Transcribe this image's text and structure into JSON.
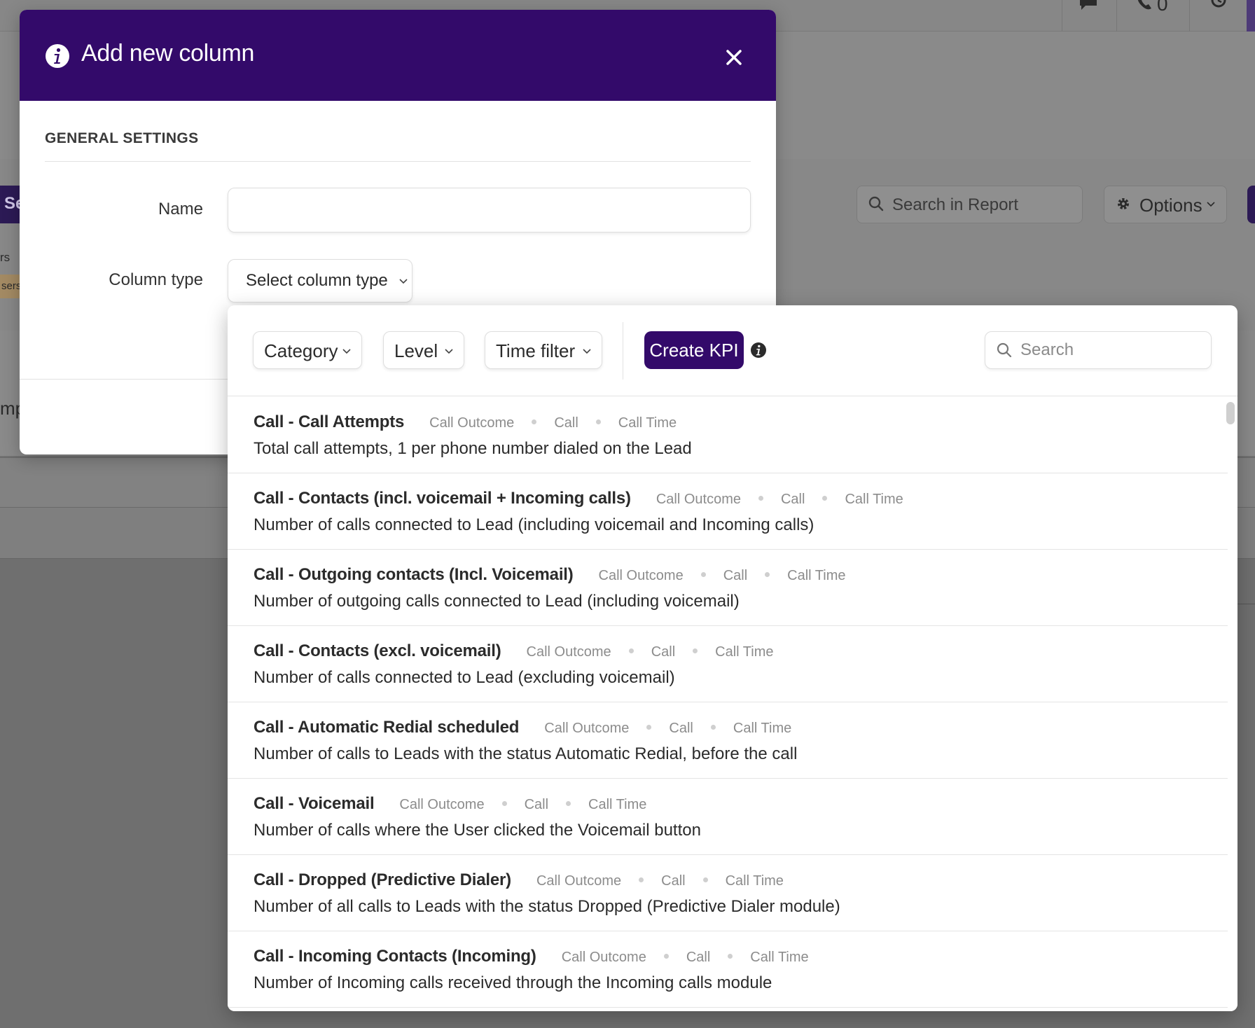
{
  "background": {
    "left_button_fragment": "Se",
    "left_text_fragment_1": "rs",
    "left_badge_fragment": "sers",
    "left_text_fragment_2": "mp",
    "topbar_count": "0",
    "search_label": "Search in Report",
    "options_label": "Options"
  },
  "modal": {
    "title": "Add new column",
    "section_title": "GENERAL SETTINGS",
    "name_label": "Name",
    "name_value": "",
    "column_type_label": "Column type",
    "column_type_value": "Select column type"
  },
  "panel": {
    "filters": {
      "category": "Category",
      "level": "Level",
      "time_filter": "Time filter"
    },
    "create_kpi_label": "Create KPI",
    "search_placeholder": "Search",
    "items": [
      {
        "title": "Call - Call Attempts",
        "tags": [
          "Call Outcome",
          "Call",
          "Call Time"
        ],
        "description": "Total call attempts, 1 per phone number dialed on the Lead"
      },
      {
        "title": "Call - Contacts (incl. voicemail + Incoming calls)",
        "tags": [
          "Call Outcome",
          "Call",
          "Call Time"
        ],
        "description": "Number of calls connected to Lead (including voicemail and Incoming calls)"
      },
      {
        "title": "Call - Outgoing contacts (Incl. Voicemail)",
        "tags": [
          "Call Outcome",
          "Call",
          "Call Time"
        ],
        "description": "Number of outgoing calls connected to Lead (including voicemail)"
      },
      {
        "title": "Call - Contacts (excl. voicemail)",
        "tags": [
          "Call Outcome",
          "Call",
          "Call Time"
        ],
        "description": "Number of calls connected to Lead (excluding voicemail)"
      },
      {
        "title": "Call - Automatic Redial scheduled",
        "tags": [
          "Call Outcome",
          "Call",
          "Call Time"
        ],
        "description": "Number of calls to Leads with the status Automatic Redial, before the call"
      },
      {
        "title": "Call - Voicemail",
        "tags": [
          "Call Outcome",
          "Call",
          "Call Time"
        ],
        "description": "Number of calls where the User clicked the Voicemail button"
      },
      {
        "title": "Call - Dropped (Predictive Dialer)",
        "tags": [
          "Call Outcome",
          "Call",
          "Call Time"
        ],
        "description": "Number of all calls to Leads with the status Dropped (Predictive Dialer module)"
      },
      {
        "title": "Call - Incoming Contacts (Incoming)",
        "tags": [
          "Call Outcome",
          "Call",
          "Call Time"
        ],
        "description": "Number of Incoming calls received through the Incoming calls module"
      }
    ]
  },
  "colors": {
    "brand_purple": "#330a6a",
    "overlay_gray": "#888888",
    "tag_gray": "#8c8c8c"
  },
  "icons": {
    "header": "info-circle-icon",
    "close": "close-icon",
    "chevron": "chevron-down-icon",
    "search": "search-icon",
    "options": "gear-icon"
  }
}
